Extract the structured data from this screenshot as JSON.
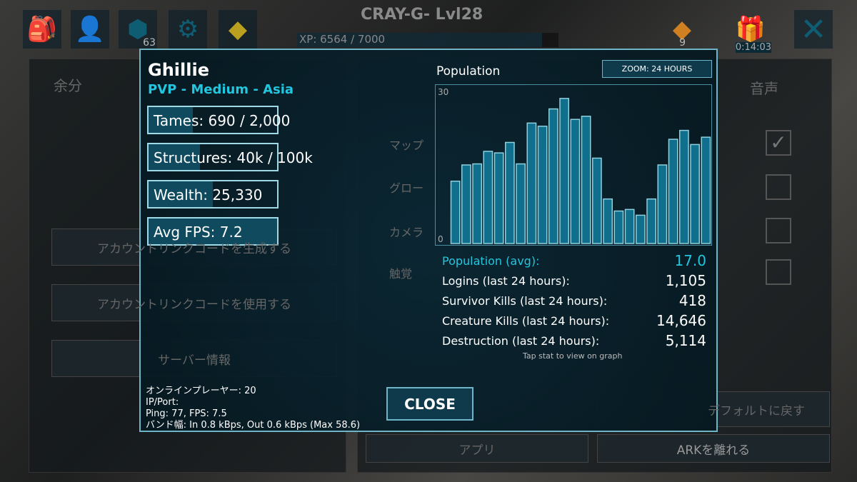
{
  "hud": {
    "title": "CRAY-G- Lvl28",
    "xp": "XP: 6564 / 7000",
    "xp_fraction": 0.938,
    "tribe_count": "63",
    "resource_count": "9",
    "timer": "0:14:03",
    "icons": [
      "backpack-icon",
      "character-icon",
      "tribe-icon",
      "settings-icon",
      "ark-crystal-icon",
      "amber-icon",
      "gift-icon",
      "close-icon"
    ]
  },
  "background": {
    "left_header": "余分",
    "right_header": "音声",
    "buttons": [
      "アカウントリンクコードを生成する",
      "アカウントリンクコードを使用する",
      "サーバー情報",
      "デフォルトに戻す",
      "アプリ",
      "ARKを離れる"
    ],
    "options": [
      "マップ",
      "グロー",
      "カメラ",
      "触覚"
    ],
    "checked": [
      true,
      false,
      false,
      false
    ]
  },
  "server": {
    "name": "Ghillie",
    "subtitle": "PVP - Medium - Asia",
    "bars": [
      {
        "label": "Tames: 690 / 2,000",
        "fill": 0.345
      },
      {
        "label": "Structures: 40k / 100k",
        "fill": 0.4
      },
      {
        "label": "Wealth: 25,330",
        "fill": 0.5
      },
      {
        "label": "Avg FPS: 7.2",
        "fill": 1.0
      }
    ],
    "info": [
      "オンラインプレーヤー:   20",
      "IP/Port:",
      "Ping: 77, FPS: 7.5",
      "バンド幅: In 0.8 kBps, Out 0.6 kBps (Max 58.6)"
    ],
    "close_label": "CLOSE"
  },
  "colors": {
    "accent": "#22c6de",
    "bar": "#0f6f8c",
    "border": "#6fb5c8"
  },
  "chart_data": {
    "type": "bar",
    "title": "Population",
    "zoom_label": "ZOOM: 24 HOURS",
    "ylim": [
      0,
      30
    ],
    "ytick_labels": [
      "30",
      "0"
    ],
    "values": [
      11.9,
      15.0,
      15.2,
      17.6,
      17.3,
      19.3,
      15.2,
      23.0,
      22.4,
      25.7,
      27.7,
      23.7,
      24.3,
      16.3,
      8.5,
      6.2,
      6.5,
      5.4,
      8.5,
      15.0,
      19.9,
      21.6,
      18.9,
      20.3
    ]
  },
  "stats": [
    {
      "label": "Population (avg):",
      "value": "17.0",
      "highlight": true
    },
    {
      "label": "Logins (last 24 hours):",
      "value": "1,105"
    },
    {
      "label": "Survivor Kills (last 24 hours):",
      "value": "418"
    },
    {
      "label": "Creature Kills (last 24 hours):",
      "value": "14,646"
    },
    {
      "label": "Destruction (last 24 hours):",
      "value": "5,114"
    }
  ],
  "hint": "Tap stat to view on graph"
}
